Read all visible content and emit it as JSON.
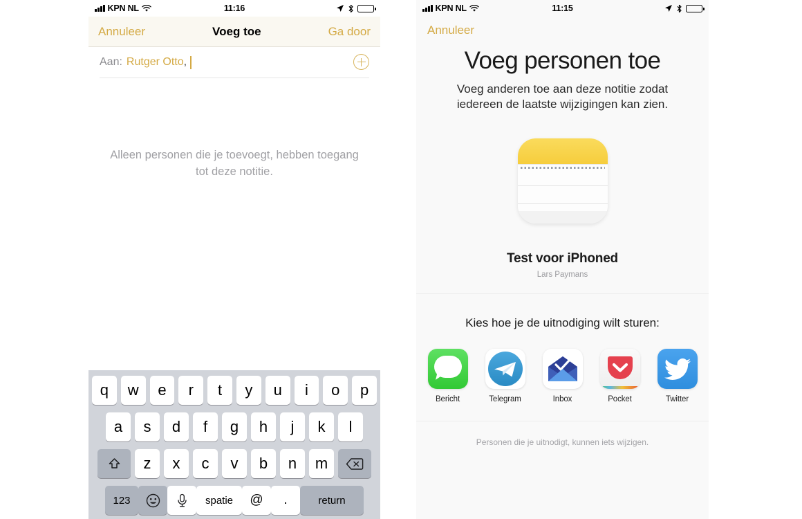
{
  "left": {
    "status_bar": {
      "carrier": "KPN NL",
      "time": "11:16",
      "wifi_icon": "wifi-icon",
      "signal_icon": "signal-bars-icon",
      "location_icon": "location-arrow-icon",
      "bluetooth_icon": "bluetooth-icon",
      "battery_icon": "battery-icon"
    },
    "navbar": {
      "cancel_label": "Annuleer",
      "title": "Voeg toe",
      "continue_label": "Ga door",
      "accent_color": "#d4aa45",
      "background_color": "#faf8f1"
    },
    "to_field": {
      "label": "Aan:",
      "recipient": "Rutger Otto",
      "separator": ",",
      "add_contact_icon": "add-contact-plus-circle-icon"
    },
    "hint": "Alleen personen die je toevoegt, hebben toegang tot deze notitie.",
    "keyboard": {
      "row1": [
        "q",
        "w",
        "e",
        "r",
        "t",
        "y",
        "u",
        "i",
        "o",
        "p"
      ],
      "row2": [
        "a",
        "s",
        "d",
        "f",
        "g",
        "h",
        "j",
        "k",
        "l"
      ],
      "row3_letters": [
        "z",
        "x",
        "c",
        "v",
        "b",
        "n",
        "m"
      ],
      "shift_icon": "shift-arrow-icon",
      "delete_icon": "backspace-delete-icon",
      "numbers_label": "123",
      "emoji_icon": "smiley-emoji-icon",
      "mic_icon": "microphone-icon",
      "space_label": "spatie",
      "at_label": "@",
      "dot_label": ".",
      "return_label": "return",
      "background_color": "#d1d4da"
    }
  },
  "right": {
    "status_bar": {
      "carrier": "KPN NL",
      "time": "11:15"
    },
    "navbar": {
      "cancel_label": "Annuleer"
    },
    "title": "Voeg personen toe",
    "subtitle": "Voeg anderen toe aan deze notitie zodat iedereen de laatste wijzigingen kan zien.",
    "note": {
      "app_icon": "notes-app-icon",
      "name": "Test voor iPhoned",
      "author": "Lars Paymans"
    },
    "share_prompt": "Kies hoe je de uitnodiging wilt sturen:",
    "apps": [
      {
        "label": "Bericht",
        "icon": "messages-app-icon",
        "color": "#32c935"
      },
      {
        "label": "Telegram",
        "icon": "telegram-app-icon",
        "color": "#2a8bc4"
      },
      {
        "label": "Inbox",
        "icon": "inbox-app-icon",
        "color": "#3f65c4"
      },
      {
        "label": "Pocket",
        "icon": "pocket-app-icon",
        "color": "#e5414e"
      },
      {
        "label": "Twitter",
        "icon": "twitter-app-icon",
        "color": "#2f8ede"
      }
    ],
    "footer": "Personen die je uitnodigt, kunnen iets wijzigen."
  }
}
